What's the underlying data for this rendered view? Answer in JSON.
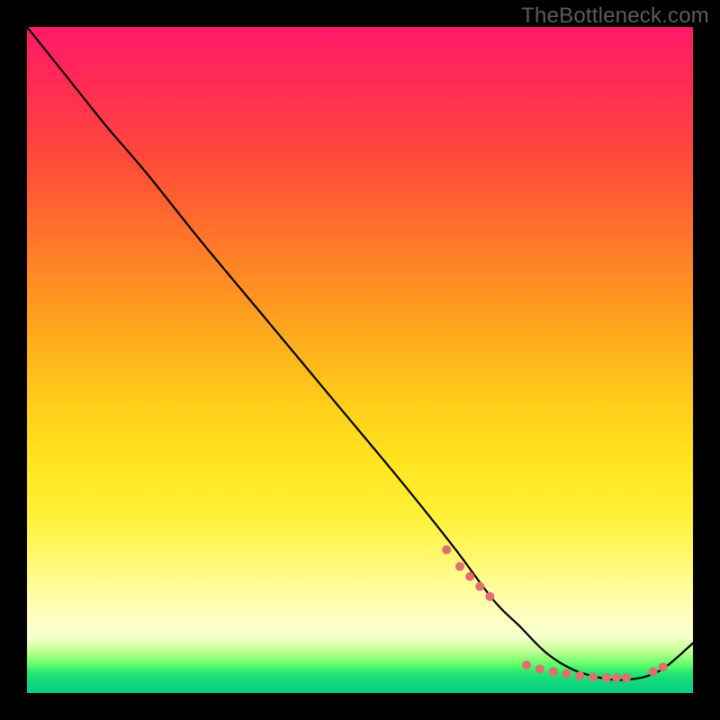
{
  "watermark": "TheBottleneck.com",
  "chart_data": {
    "type": "line",
    "title": "",
    "xlabel": "",
    "ylabel": "",
    "xlim": [
      0,
      100
    ],
    "ylim": [
      0,
      100
    ],
    "grid": false,
    "legend": false,
    "series": [
      {
        "name": "curve",
        "color": "#000000",
        "x": [
          0,
          4,
          8,
          12,
          18,
          26,
          36,
          46,
          56,
          64,
          70,
          74,
          78,
          82,
          86,
          88,
          90,
          93,
          96,
          100
        ],
        "y": [
          100,
          95,
          90,
          85,
          78,
          68,
          56,
          44,
          32,
          22,
          14,
          10,
          6,
          3.5,
          2.3,
          2.0,
          2.0,
          2.5,
          4.0,
          7.5
        ]
      }
    ],
    "markers": [
      {
        "name": "left-cluster",
        "color": "#e0706e",
        "size": 10,
        "x": [
          63,
          65,
          66.5,
          68,
          69.5
        ],
        "y": [
          21.5,
          19,
          17.5,
          16,
          14.5
        ]
      },
      {
        "name": "bottom-cluster",
        "color": "#e0706e",
        "size": 10,
        "x": [
          75,
          77,
          79,
          81,
          83,
          85,
          87,
          88.5,
          90
        ],
        "y": [
          4.2,
          3.6,
          3.2,
          2.9,
          2.6,
          2.4,
          2.3,
          2.3,
          2.3
        ]
      },
      {
        "name": "right-cluster",
        "color": "#e0706e",
        "size": 10,
        "x": [
          94,
          95.5
        ],
        "y": [
          3.2,
          3.9
        ]
      }
    ]
  }
}
